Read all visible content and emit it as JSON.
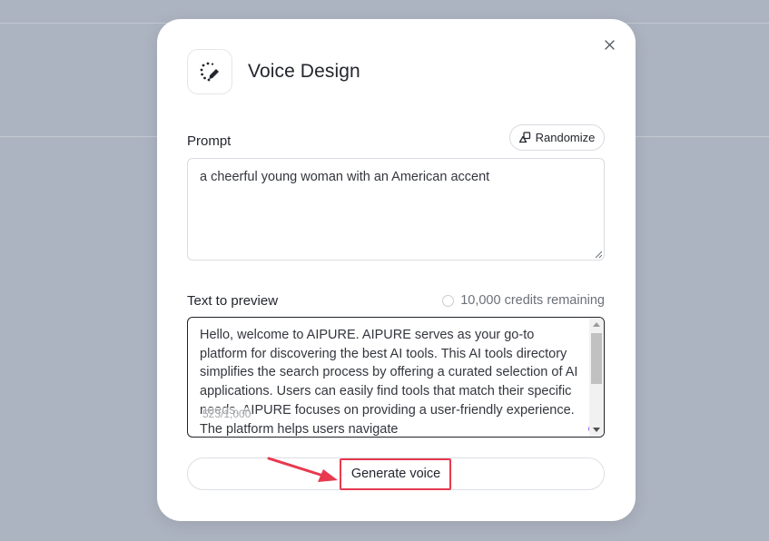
{
  "modal": {
    "title": "Voice Design",
    "close_icon": "close-icon",
    "header_icon": "voice-design-icon"
  },
  "prompt": {
    "label": "Prompt",
    "randomize_label": "Randomize",
    "randomize_icon": "shapes-icon",
    "value": "a cheerful young woman with an American accent"
  },
  "preview": {
    "label": "Text to preview",
    "credits": "10,000 credits remaining",
    "text": "Hello, welcome to AIPURE. AIPURE serves as your go-to platform for discovering the best AI tools. This AI tools directory simplifies the search process by offering a curated selection of AI applications. Users can easily find tools that match their specific needs. AIPURE focuses on providing a user-friendly experience. The platform helps users navigate",
    "char_count": "523/1,000"
  },
  "generate": {
    "label": "Generate voice"
  },
  "colors": {
    "overlay": "#adb4c1",
    "highlight": "#e8394f",
    "accent_dot": "#8b5cf6"
  }
}
